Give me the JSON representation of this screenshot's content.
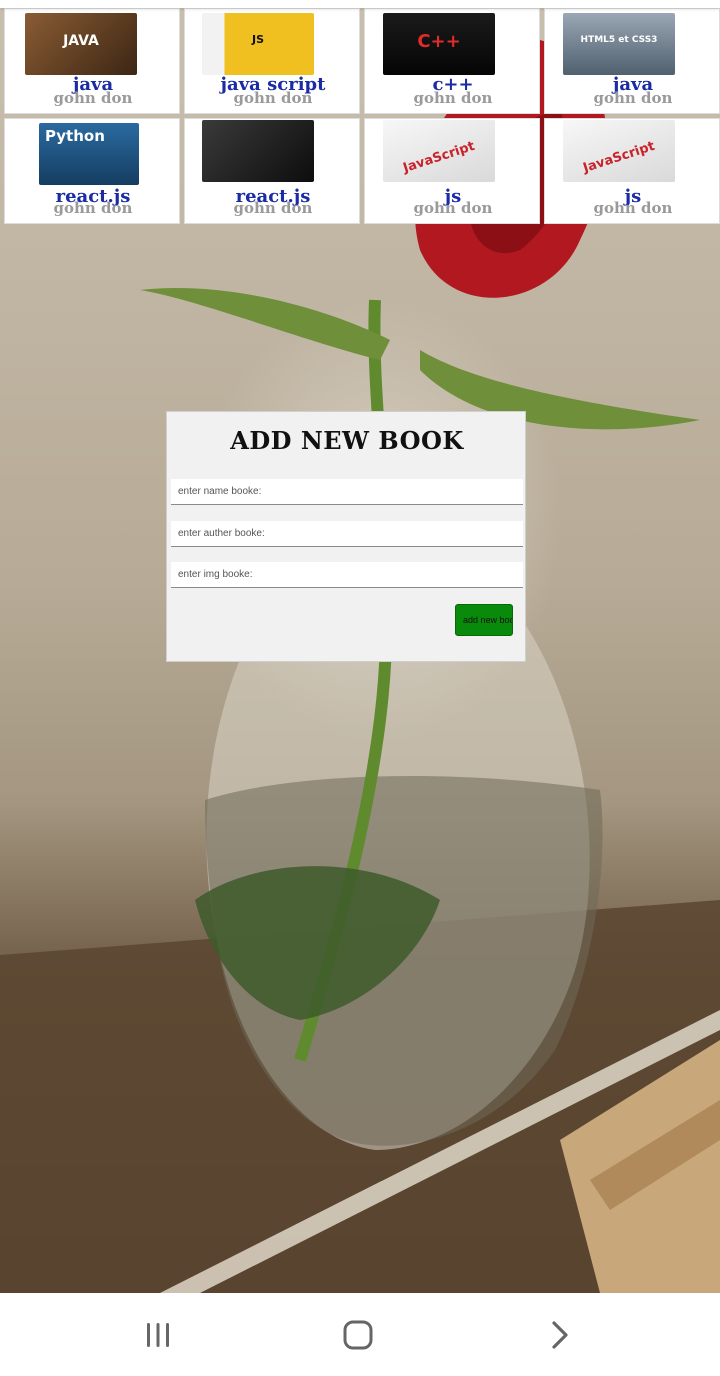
{
  "books": [
    {
      "title": "java",
      "author": "gohn don",
      "cover_color": "#6b4a2e",
      "cover_icon": "java-book-cover"
    },
    {
      "title": "java script",
      "author": "gohn don",
      "cover_color": "#e8b510",
      "cover_icon": "javascript-arabic-book-cover"
    },
    {
      "title": "c++",
      "author": "gohn don",
      "cover_color": "#141414",
      "cover_icon": "cpp-book-cover"
    },
    {
      "title": "java",
      "author": "gohn don",
      "cover_color": "#6f7f8f",
      "cover_icon": "html5-css3-book-cover"
    },
    {
      "title": "react.js",
      "author": "gohn don",
      "cover_color": "#1f5a8c",
      "cover_icon": "python-book-cover"
    },
    {
      "title": "react.js",
      "author": "gohn don",
      "cover_color": "#1a1a1a",
      "cover_icon": "dark-book-cover"
    },
    {
      "title": "js",
      "author": "gohn don",
      "cover_color": "#e9e9e9",
      "cover_icon": "javascript-book-cover"
    },
    {
      "title": "js",
      "author": "gohn don",
      "cover_color": "#e9e9e9",
      "cover_icon": "javascript-book-cover"
    }
  ],
  "form": {
    "title": "ADD NEW BOOK",
    "name_placeholder": "enter name booke:",
    "author_placeholder": "enter auther booke:",
    "img_placeholder": "enter img booke:",
    "submit_label": "add new book",
    "submit_color": "#0a8a0a"
  },
  "nav": {
    "recents_icon": "recent-apps-icon",
    "home_icon": "home-icon",
    "back_icon": "back-chevron-icon"
  }
}
